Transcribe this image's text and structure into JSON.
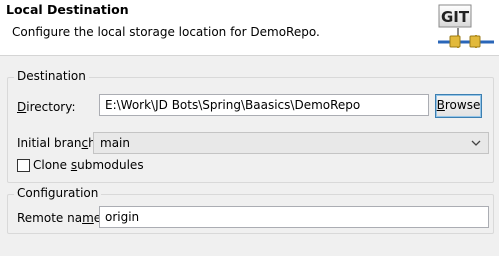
{
  "header": {
    "title": "Local Destination",
    "description": "Configure the local storage location for DemoRepo.",
    "logo_text": "GIT"
  },
  "destination": {
    "group_title": "Destination",
    "directory_label_prefix": "",
    "directory_label_mnemonic": "D",
    "directory_label_rest": "irectory:",
    "directory_value": "E:\\Work\\JD Bots\\Spring\\Baasics\\DemoRepo",
    "browse_prefix": "",
    "browse_mnemonic": "B",
    "browse_rest": "rowse",
    "branch_label_prefix": "Initial bran",
    "branch_label_mnemonic": "c",
    "branch_label_rest": "h:",
    "branch_value": "main",
    "clone_label_prefix": "Clone ",
    "clone_label_mnemonic": "s",
    "clone_label_rest": "ubmodules",
    "clone_checked": false
  },
  "configuration": {
    "group_title": "Configuration",
    "remote_label_prefix": "Remote na",
    "remote_label_mnemonic": "m",
    "remote_label_rest": "e:",
    "remote_value": "origin"
  }
}
